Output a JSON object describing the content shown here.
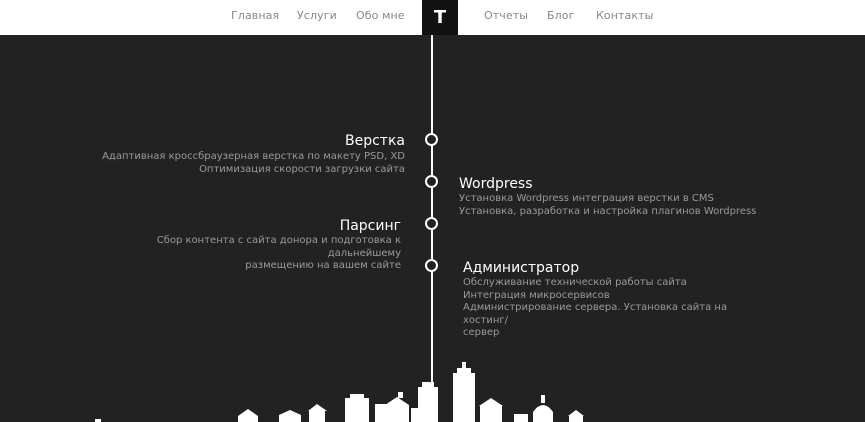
{
  "nav": {
    "left": [
      "Главная",
      "Услуги",
      "Обо мне"
    ],
    "logo": "T",
    "right": [
      "Отчеты",
      "Блог",
      "Контакты"
    ]
  },
  "timeline": {
    "items": [
      {
        "title": "Верстка",
        "lines": [
          "Адаптивная кроссбраузерная верстка по макету PSD, XD",
          "Оптимизация скорости загрузки сайта"
        ]
      },
      {
        "title": "Wordpress",
        "lines": [
          "Установка Wordpress интеграция верстки в CMS",
          "Установка, разработка и настройка плагинов Wordpress"
        ]
      },
      {
        "title": "Парсинг",
        "lines": [
          "Сбор контента с сайта донора и подготовка к дальнейшему",
          "размещению на вашем сайте"
        ]
      },
      {
        "title": "Администратор",
        "lines": [
          "Обслуживание технической работы сайта",
          "Интеграция микросервисов",
          "Администрирование сервера. Установка сайта на хостинг/",
          "сервер"
        ]
      }
    ]
  },
  "colors": {
    "background": "#222222",
    "header": "#ffffff",
    "logo_bg": "#111111",
    "nav_text": "#888888",
    "title_text": "#ffffff",
    "desc_text": "#9a9a9a"
  },
  "icons": {
    "skyline": "city-skyline-illustration"
  }
}
